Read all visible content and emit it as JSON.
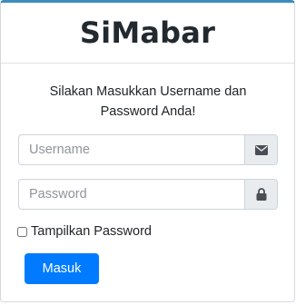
{
  "header": {
    "title": "SiMabar"
  },
  "login": {
    "message_line1": "Silakan Masukkan Username dan",
    "message_line2": "Password Anda!",
    "username_placeholder": "Username",
    "username_value": "",
    "username_icon": "envelope-icon",
    "password_placeholder": "Password",
    "password_value": "",
    "password_icon": "lock-icon",
    "show_password_label": "Tampilkan Password",
    "show_password_checked": false,
    "submit_label": "Masuk"
  },
  "colors": {
    "accent_border": "#3c8dbc",
    "primary_button": "#007bff",
    "addon_background": "#e9ecef",
    "icon": "#4a4f55"
  }
}
